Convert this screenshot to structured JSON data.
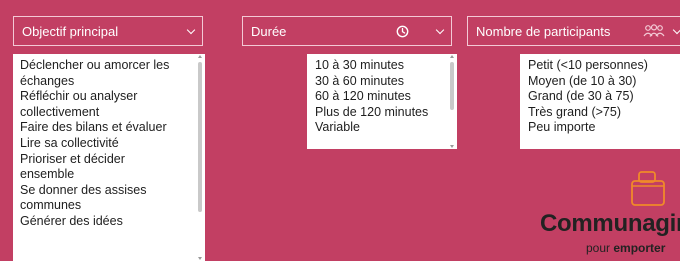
{
  "objectif": {
    "label": "Objectif principal",
    "items": [
      "Déclencher ou amorcer les",
      "échanges",
      "Réfléchir ou analyser",
      "collectivement",
      "Faire des bilans et évaluer",
      "Lire sa collectivité",
      "Prioriser et décider",
      "ensemble",
      "Se donner des assises",
      "communes",
      "Générer des idées"
    ]
  },
  "duree": {
    "label": "Durée",
    "items": [
      "10 à 30 minutes",
      "30 à 60 minutes",
      "60 à 120 minutes",
      "Plus de 120 minutes",
      "Variable"
    ]
  },
  "participants": {
    "label": "Nombre de participants",
    "items": [
      "Petit (<10 personnes)",
      "Moyen (de 10 à 30)",
      "Grand (de 30 à 75)",
      "Très grand (>75)",
      "Peu importe"
    ]
  },
  "logo": {
    "name": "Communagir",
    "tagline_prefix": "pour ",
    "tagline_bold": "emporter"
  },
  "colors": {
    "background": "#c23f63",
    "logo_orange": "#f08a2a"
  },
  "icons": {
    "duree": "clock-icon",
    "participants": "group-icon",
    "dropdown": "chevron-down-icon",
    "logo": "briefcase-icon"
  }
}
